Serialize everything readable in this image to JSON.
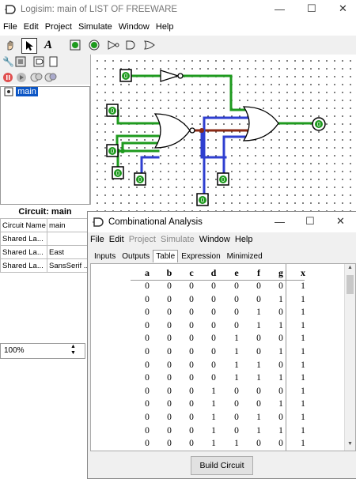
{
  "main_window": {
    "title": "Logisim: main of LIST OF FREEWARE",
    "menu": [
      "File",
      "Edit",
      "Project",
      "Simulate",
      "Window",
      "Help"
    ]
  },
  "explorer": {
    "tree_item": "main"
  },
  "properties": {
    "title": "Circuit: main",
    "rows": [
      {
        "name": "Circuit Name",
        "value": "main"
      },
      {
        "name": "Shared La...",
        "value": ""
      },
      {
        "name": "Shared La...",
        "value": "East"
      },
      {
        "name": "Shared La...",
        "value": "SansSerif ..."
      }
    ]
  },
  "zoom": "100%",
  "canvas": {
    "pins": {
      "pin1": "0",
      "pin2": "0",
      "pin3": "0",
      "pin4": "0",
      "pin5": "0",
      "pin6": "0",
      "pin7": "0",
      "pin8": "0",
      "out": "0"
    }
  },
  "dialog": {
    "title": "Combinational Analysis",
    "menu": [
      {
        "label": "File",
        "disabled": false
      },
      {
        "label": "Edit",
        "disabled": false
      },
      {
        "label": "Project",
        "disabled": true
      },
      {
        "label": "Simulate",
        "disabled": true
      },
      {
        "label": "Window",
        "disabled": false
      },
      {
        "label": "Help",
        "disabled": false
      }
    ],
    "tabs": [
      "Inputs",
      "Outputs",
      "Table",
      "Expression",
      "Minimized"
    ],
    "active_tab": "Table",
    "table": {
      "headers": [
        "a",
        "b",
        "c",
        "d",
        "e",
        "f",
        "g",
        "x"
      ],
      "rows": [
        [
          "0",
          "0",
          "0",
          "0",
          "0",
          "0",
          "0",
          "1"
        ],
        [
          "0",
          "0",
          "0",
          "0",
          "0",
          "0",
          "1",
          "1"
        ],
        [
          "0",
          "0",
          "0",
          "0",
          "0",
          "1",
          "0",
          "1"
        ],
        [
          "0",
          "0",
          "0",
          "0",
          "0",
          "1",
          "1",
          "1"
        ],
        [
          "0",
          "0",
          "0",
          "0",
          "1",
          "0",
          "0",
          "1"
        ],
        [
          "0",
          "0",
          "0",
          "0",
          "1",
          "0",
          "1",
          "1"
        ],
        [
          "0",
          "0",
          "0",
          "0",
          "1",
          "1",
          "0",
          "1"
        ],
        [
          "0",
          "0",
          "0",
          "0",
          "1",
          "1",
          "1",
          "1"
        ],
        [
          "0",
          "0",
          "0",
          "1",
          "0",
          "0",
          "0",
          "1"
        ],
        [
          "0",
          "0",
          "0",
          "1",
          "0",
          "0",
          "1",
          "1"
        ],
        [
          "0",
          "0",
          "0",
          "1",
          "0",
          "1",
          "0",
          "1"
        ],
        [
          "0",
          "0",
          "0",
          "1",
          "0",
          "1",
          "1",
          "1"
        ],
        [
          "0",
          "0",
          "0",
          "1",
          "1",
          "0",
          "0",
          "1"
        ]
      ]
    },
    "build_button": "Build Circuit"
  },
  "colors": {
    "wire_high": "#1e9a1e",
    "wire_bus": "#2f3fd0",
    "wire_dark": "#8a2a15",
    "selection": "#0b55c5"
  }
}
